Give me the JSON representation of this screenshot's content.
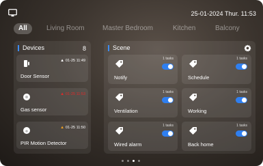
{
  "status_bar": {
    "datetime": "25-01-2024 Thur. 11:53"
  },
  "tabs": [
    {
      "label": "All",
      "active": true
    },
    {
      "label": "Living Room",
      "active": false
    },
    {
      "label": "Master Bedroom",
      "active": false
    },
    {
      "label": "Kitchen",
      "active": false
    },
    {
      "label": "Balcony",
      "active": false
    }
  ],
  "devices": {
    "title": "Devices",
    "count": "8",
    "items": [
      {
        "name": "Door Sensor",
        "time": "01-25 11:49",
        "alert_color": "#ffffff",
        "icon": "door-sensor-icon"
      },
      {
        "name": "Gas sensor",
        "time": "01-25 11:53",
        "alert_color": "#e02a2a",
        "icon": "gas-sensor-icon"
      },
      {
        "name": "PIR Motion Detector",
        "time": "01-25 11:50",
        "alert_color": "#f0a020",
        "icon": "motion-detector-icon"
      }
    ]
  },
  "scene": {
    "title": "Scene",
    "items": [
      {
        "name": "Notify",
        "tasks": "1 tasks",
        "enabled": true
      },
      {
        "name": "Schedule",
        "tasks": "1 tasks",
        "enabled": true
      },
      {
        "name": "Ventilation",
        "tasks": "1 tasks",
        "enabled": true
      },
      {
        "name": "Working",
        "tasks": "1 tasks",
        "enabled": true
      },
      {
        "name": "Wired alarm",
        "tasks": "1 tasks",
        "enabled": true
      },
      {
        "name": "Back home",
        "tasks": "1 tasks",
        "enabled": true
      }
    ]
  },
  "pagination": {
    "pages": 4,
    "current": 3
  },
  "colors": {
    "accent": "#2f7ff0",
    "gas_alert": "#e02a2a",
    "motion_alert": "#f0a020"
  }
}
